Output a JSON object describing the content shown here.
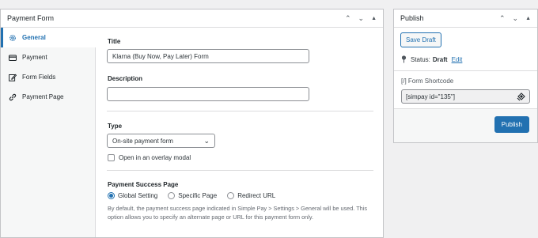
{
  "payment_box": {
    "title": "Payment Form",
    "icons": [
      "chevron-up-icon",
      "chevron-down-icon",
      "triangle-up-icon"
    ],
    "tabs": [
      {
        "label": "General",
        "icon": "gear-icon",
        "active": true
      },
      {
        "label": "Payment",
        "icon": "card-icon",
        "active": false
      },
      {
        "label": "Form Fields",
        "icon": "edit-icon",
        "active": false
      },
      {
        "label": "Payment Page",
        "icon": "link-icon",
        "active": false
      }
    ],
    "general": {
      "title_label": "Title",
      "title_value": "Klarna (Buy Now, Pay Later) Form",
      "description_label": "Description",
      "description_value": "",
      "type_label": "Type",
      "type_value": "On-site payment form",
      "overlay_label": "Open in an overlay modal",
      "success_label": "Payment Success Page",
      "success_options": [
        "Global Setting",
        "Specific Page",
        "Redirect URL"
      ],
      "success_selected": "Global Setting",
      "success_help": "By default, the payment success page indicated in Simple Pay > Settings > General will be used. This option allows you to specify an alternate page or URL for this payment form only."
    }
  },
  "publish_box": {
    "title": "Publish",
    "save_draft_label": "Save Draft",
    "status_prefix": "Status:",
    "status_value": "Draft",
    "status_edit": "Edit",
    "shortcode_label": "[/]  Form Shortcode",
    "shortcode_value": "[simpay id=\"135\"]",
    "publish_label": "Publish"
  },
  "colors": {
    "accent": "#2271b1",
    "background": "#f0f0f1",
    "border": "#c3c4c7"
  }
}
